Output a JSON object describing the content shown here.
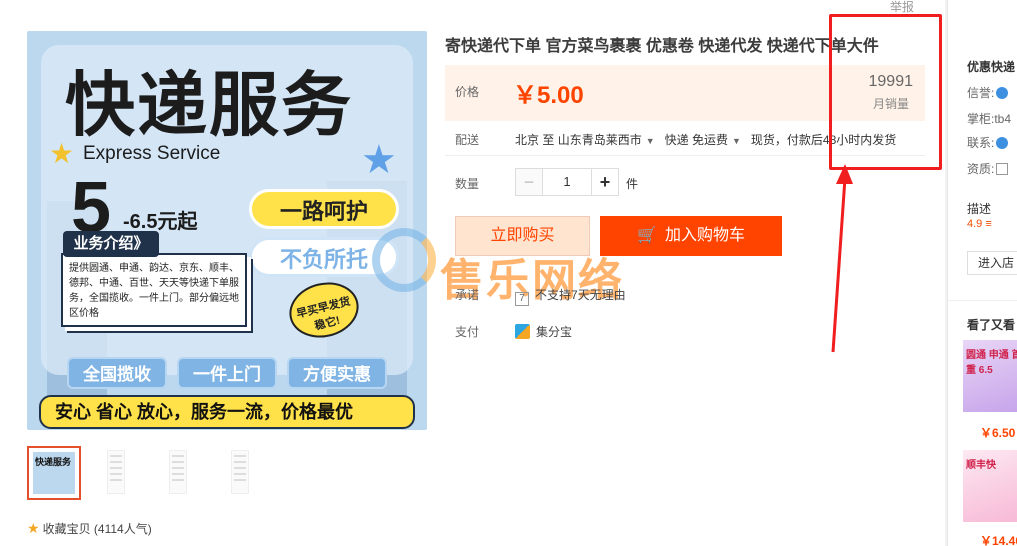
{
  "product": {
    "title": "寄快递代下单 官方菜鸟裹裹 优惠卷 快递代发 快递代下单大件",
    "price_label": "价格",
    "price": "￥5.00",
    "sales_count": "19991",
    "sales_label": "月销量",
    "shipping_label": "配送",
    "ship_from": "北京 至",
    "ship_to": "山东青岛莱西市",
    "ship_method": "快递 免运费",
    "ship_note": "现货，付款后48小时内发货",
    "quantity_label": "数量",
    "quantity_value": "1",
    "quantity_unit": "件",
    "buy_now": "立即购买",
    "add_to_cart": "加入购物车",
    "promise_label": "承诺",
    "promise_text": "不支持7天无理由",
    "payment_label": "支付",
    "payment_text": "集分宝",
    "report": "举报",
    "favorite": "收藏宝贝 (4114人气)"
  },
  "image": {
    "title": "快递服务",
    "subtitle": "Express Service",
    "five": "5",
    "price_range": "-6.5元起",
    "pill_yellow": "一路呵护",
    "pill_white": "不负所托",
    "intro_tab": "业务介绍》",
    "intro_text": "提供圆通、申通、韵达、京东、顺丰、德邦、中通、百世、天天等快递下单服务，全国揽收。一件上门。部分偏远地区价格",
    "badge": "早买早发货 稳它!",
    "feature_1": "全国揽收",
    "feature_2": "一件上门",
    "feature_3": "方便实惠",
    "banner": "安心 省心 放心，服务一流，价格最优",
    "thumb_1": "快递服务"
  },
  "watermark": "售乐网络",
  "right_panel": {
    "shop_name": "优惠快递",
    "credit_label": "信誉:",
    "owner_label": "掌柜:",
    "owner_value": "tb4",
    "contact_label": "联系:",
    "qualification_label": "资质:",
    "desc_label": "描述",
    "desc_score": "4.9 ≡",
    "enter_shop": "进入店",
    "also_viewed": "看了又看",
    "item1_text": "圆通 申通 首重 6.5",
    "item1_price": "￥6.50",
    "item2_text": "顺丰快",
    "item2_price": "￥14.40"
  },
  "colors": {
    "accent": "#ff4400",
    "annotation": "#f01e1e",
    "price_bg": "#fff2e8"
  }
}
